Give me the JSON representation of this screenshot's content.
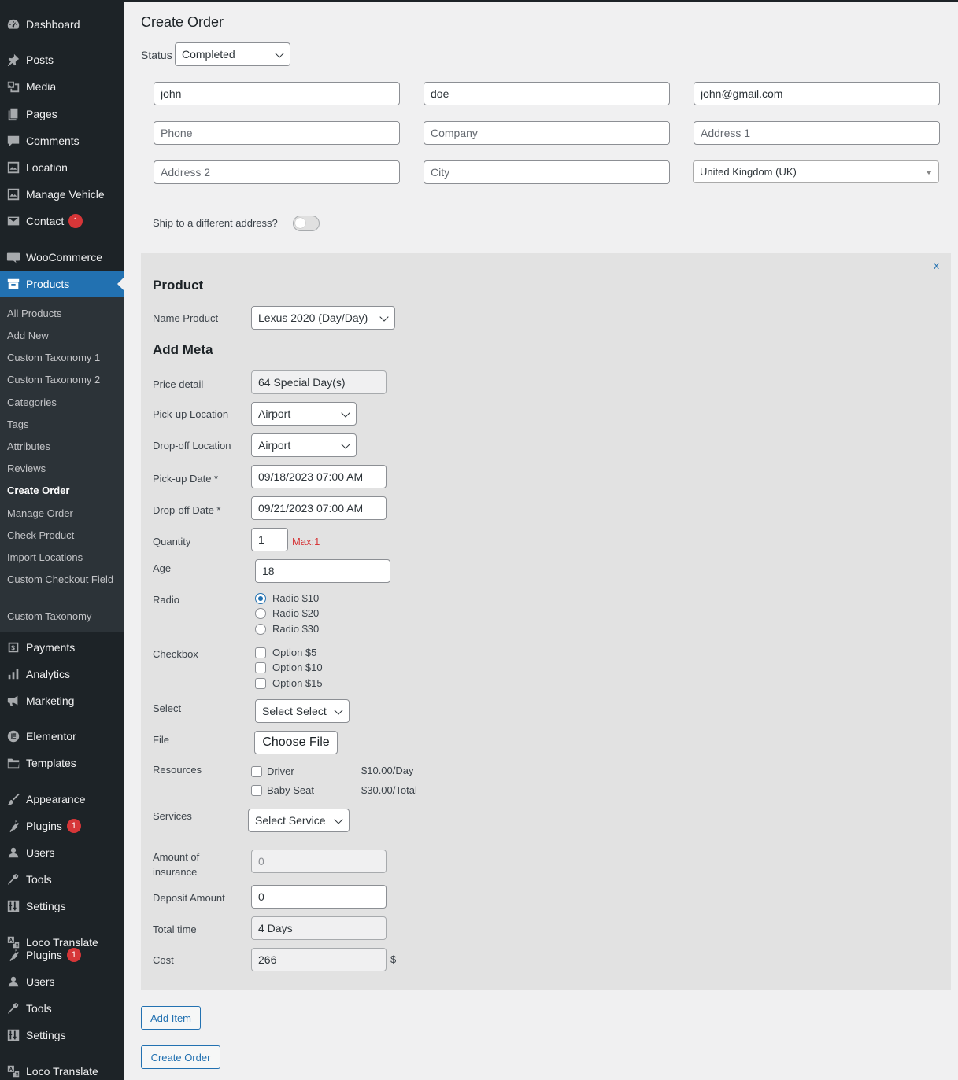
{
  "sidebar": {
    "items": [
      {
        "key": "dashboard",
        "label": "Dashboard",
        "icon": "dashboard-icon"
      },
      {
        "key": "posts",
        "label": "Posts",
        "icon": "pin-icon"
      },
      {
        "key": "media",
        "label": "Media",
        "icon": "media-icon"
      },
      {
        "key": "pages",
        "label": "Pages",
        "icon": "pages-icon"
      },
      {
        "key": "comments",
        "label": "Comments",
        "icon": "comment-icon"
      },
      {
        "key": "location",
        "label": "Location",
        "icon": "location-icon"
      },
      {
        "key": "manage-vehicle",
        "label": "Manage Vehicle",
        "icon": "vehicle-icon"
      },
      {
        "key": "contact",
        "label": "Contact",
        "icon": "mail-icon",
        "badge": "1"
      },
      {
        "key": "woocommerce",
        "label": "WooCommerce",
        "icon": "woo-icon"
      },
      {
        "key": "products",
        "label": "Products",
        "icon": "archive-icon",
        "active": true
      },
      {
        "key": "payments",
        "label": "Payments",
        "icon": "dollar-icon"
      },
      {
        "key": "analytics",
        "label": "Analytics",
        "icon": "chart-icon"
      },
      {
        "key": "marketing",
        "label": "Marketing",
        "icon": "megaphone-icon"
      },
      {
        "key": "elementor",
        "label": "Elementor",
        "icon": "elementor-icon"
      },
      {
        "key": "templates",
        "label": "Templates",
        "icon": "folder-icon"
      },
      {
        "key": "appearance",
        "label": "Appearance",
        "icon": "brush-icon"
      },
      {
        "key": "plugins",
        "label": "Plugins",
        "icon": "plugin-icon",
        "badge": "1"
      },
      {
        "key": "users",
        "label": "Users",
        "icon": "user-icon"
      },
      {
        "key": "tools",
        "label": "Tools",
        "icon": "wrench-icon"
      },
      {
        "key": "settings",
        "label": "Settings",
        "icon": "settings-icon"
      },
      {
        "key": "loco-translate",
        "label": "Loco Translate",
        "icon": "translate-icon"
      },
      {
        "key": "plugins-2",
        "label": "Plugins",
        "icon": "plugin-icon",
        "badge": "1"
      },
      {
        "key": "users-2",
        "label": "Users",
        "icon": "user-icon"
      },
      {
        "key": "tools-2",
        "label": "Tools",
        "icon": "wrench-icon"
      },
      {
        "key": "settings-2",
        "label": "Settings",
        "icon": "settings-icon"
      },
      {
        "key": "loco-translate-2",
        "label": "Loco Translate",
        "icon": "translate-icon"
      }
    ],
    "submenu": [
      "All Products",
      "Add New",
      "Custom Taxonomy 1",
      "Custom Taxonomy 2",
      "Categories",
      "Tags",
      "Attributes",
      "Reviews",
      "Create Order",
      "Manage Order",
      "Check Product",
      "Import Locations",
      "Custom Checkout Field",
      "Custom Taxonomy"
    ],
    "submenu_current": "Create Order"
  },
  "page": {
    "title": "Create Order",
    "status_label": "Status",
    "status_value": "Completed"
  },
  "billing": {
    "first_name": "john",
    "last_name": "doe",
    "email": "john@gmail.com",
    "phone_placeholder": "Phone",
    "company_placeholder": "Company",
    "address1_placeholder": "Address 1",
    "address2_placeholder": "Address 2",
    "city_placeholder": "City",
    "country": "United Kingdom (UK)",
    "ship_label": "Ship to a different address?"
  },
  "item": {
    "close": "x",
    "product_heading": "Product",
    "name_product_label": "Name Product",
    "name_product_value": "Lexus 2020 (Day/Day)",
    "meta_heading": "Add Meta",
    "price_detail_label": "Price detail",
    "price_detail_value": "64 Special Day(s)",
    "pickup_location_label": "Pick-up Location",
    "pickup_location_value": "Airport",
    "dropoff_location_label": "Drop-off Location",
    "dropoff_location_value": "Airport",
    "pickup_date_label": "Pick-up Date *",
    "pickup_date_value": "09/18/2023 07:00 AM",
    "dropoff_date_label": "Drop-off Date *",
    "dropoff_date_value": "09/21/2023 07:00 AM",
    "quantity_label": "Quantity",
    "quantity_value": "1",
    "quantity_max": "Max:1",
    "age_label": "Age",
    "age_value": "18",
    "radio_label": "Radio",
    "radio_options": [
      "Radio $10",
      "Radio $20",
      "Radio $30"
    ],
    "radio_selected": 0,
    "checkbox_label": "Checkbox",
    "checkbox_options": [
      "Option $5",
      "Option $10",
      "Option $15"
    ],
    "select_label": "Select",
    "select_value": "Select Select",
    "file_label": "File",
    "file_button": "Choose File",
    "resources_label": "Resources",
    "resources": [
      {
        "name": "Driver",
        "price": "$10.00/Day"
      },
      {
        "name": "Baby Seat",
        "price": "$30.00/Total"
      }
    ],
    "services_label": "Services",
    "services_value": "Select Service",
    "insurance_label": "Amount of insurance",
    "insurance_value": "0",
    "deposit_label": "Deposit Amount",
    "deposit_value": "0",
    "total_time_label": "Total time",
    "total_time_value": "4 Days",
    "cost_label": "Cost",
    "cost_value": "266",
    "currency": "$"
  },
  "actions": {
    "add_item": "Add Item",
    "create_order": "Create Order"
  },
  "colors": {
    "sidebar_bg": "#1d2327",
    "submenu_bg": "#2c3338",
    "accent": "#2271b1",
    "badge": "#d63638"
  }
}
